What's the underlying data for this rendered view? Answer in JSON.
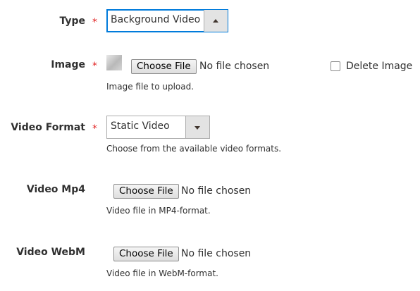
{
  "fields": {
    "type": {
      "label": "Type",
      "required_mark": "*",
      "value": "Background Video",
      "arrow_icon": "chevron-up-icon"
    },
    "image": {
      "label": "Image",
      "required_mark": "*",
      "button": "Choose File",
      "file_status": "No file chosen",
      "note": "Image file to upload.",
      "delete_label": "Delete Image",
      "delete_checked": false
    },
    "video_format": {
      "label": "Video Format",
      "required_mark": "*",
      "value": "Static Video",
      "arrow_icon": "chevron-down-icon",
      "note": "Choose from the available video formats."
    },
    "video_mp4": {
      "label": "Video Mp4",
      "button": "Choose File",
      "file_status": "No file chosen",
      "note": "Video file in MP4-format."
    },
    "video_webm": {
      "label": "Video WebM",
      "button": "Choose File",
      "file_status": "No file chosen",
      "note": "Video file in WebM-format."
    }
  },
  "colors": {
    "required": "#e22626",
    "focus_border": "#007bdb",
    "text": "#303030"
  }
}
